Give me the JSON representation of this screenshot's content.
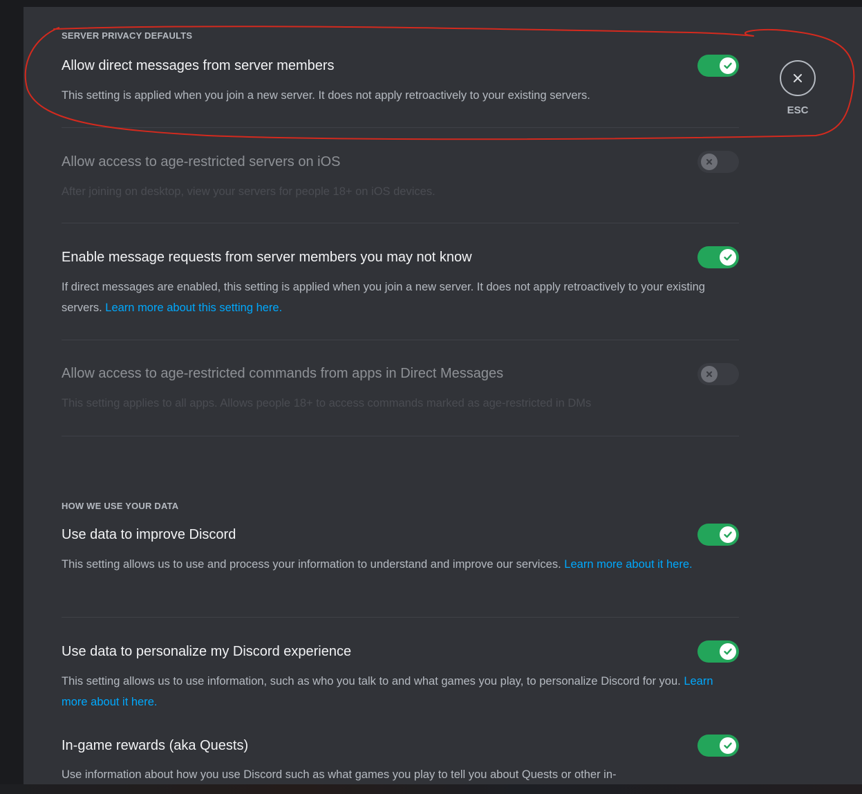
{
  "close": {
    "esc_label": "ESC"
  },
  "sections": {
    "server_privacy": {
      "header": "SERVER PRIVACY DEFAULTS",
      "settings": [
        {
          "title": "Allow direct messages from server members",
          "description": "This setting is applied when you join a new server. It does not apply retroactively to your existing servers.",
          "enabled": true
        },
        {
          "title": "Allow access to age-restricted servers on iOS",
          "description": "After joining on desktop, view your servers for people 18+ on iOS devices.",
          "enabled": false
        },
        {
          "title": "Enable message requests from server members you may not know",
          "description": "If direct messages are enabled, this setting is applied when you join a new server. It does not apply retroactively to your existing servers.",
          "link": "Learn more about this setting here.",
          "enabled": true
        },
        {
          "title": "Allow access to age-restricted commands from apps in Direct Messages",
          "description": "This setting applies to all apps. Allows people 18+ to access commands marked as age-restricted in DMs",
          "enabled": false
        }
      ]
    },
    "data_usage": {
      "header": "HOW WE USE YOUR DATA",
      "settings": [
        {
          "title": "Use data to improve Discord",
          "description": "This setting allows us to use and process your information to understand and improve our services.",
          "link": "Learn more about it here.",
          "enabled": true
        },
        {
          "title": "Use data to personalize my Discord experience",
          "description": "This setting allows us to use information, such as who you talk to and what games you play, to personalize Discord for you.",
          "link": "Learn more about it here.",
          "enabled": true
        },
        {
          "title": "In-game rewards (aka Quests)",
          "description": "Use information about how you use Discord such as what games you play to tell you about Quests or other in-",
          "enabled": true
        }
      ]
    }
  },
  "colors": {
    "background": "#313338",
    "toggle_on": "#23a55a",
    "toggle_off": "#3a3c42",
    "link": "#00a8fc",
    "annotation": "#d42a1e"
  },
  "icons": {
    "close": "close-icon",
    "toggle_on": "checkmark-icon",
    "toggle_off": "x-icon"
  }
}
